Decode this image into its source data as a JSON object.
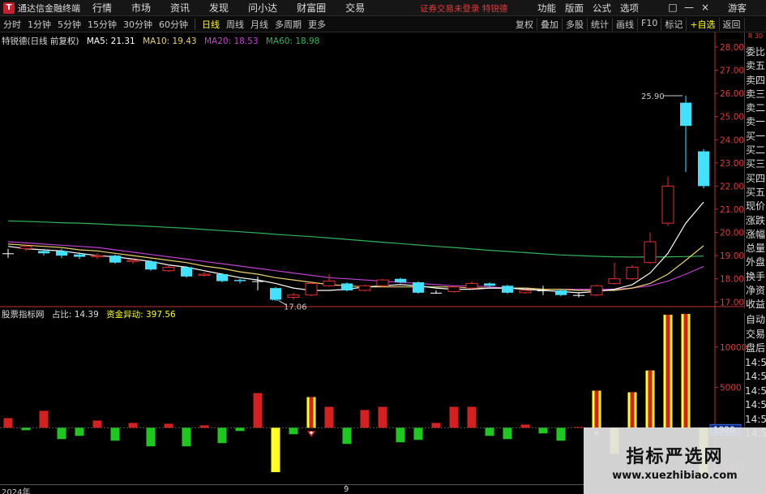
{
  "titlebar": {
    "app_title": "通达信金融终端",
    "menu": [
      "行情",
      "市场",
      "资讯",
      "发现",
      "问小达",
      "财富圈",
      "交易"
    ],
    "login_warning": "证券交易未登录  特锐德",
    "right_menu": [
      "功能",
      "版面",
      "公式",
      "选项"
    ],
    "window_controls": [
      "□",
      "—",
      "×"
    ],
    "zoom_label": "游客"
  },
  "toolbar": {
    "periods": [
      "分时",
      "1分钟",
      "5分钟",
      "15分钟",
      "30分钟",
      "60分钟",
      "日线",
      "周线",
      "月线",
      "多周期",
      "更多"
    ],
    "active_period": "日线",
    "right_tools": [
      "复权",
      "叠加",
      "多股",
      "统计",
      "画线",
      "F10",
      "标记",
      "+自选",
      "返回"
    ]
  },
  "kline_legend": {
    "name": "特锐德(日线 前复权)",
    "ma5": "MA5: 21.31",
    "ma10": "MA10: 19.43",
    "ma20": "MA20: 18.53",
    "ma60": "MA60: 18.98"
  },
  "price_axis": {
    "ticks": [
      "28.00",
      "27.00",
      "26.00",
      "25.00",
      "24.00",
      "23.00",
      "22.00",
      "21.00",
      "20.00",
      "19.00",
      "18.00",
      "17.00"
    ],
    "ymax": 28.0,
    "ymin": 16.8,
    "high_label": "25.90",
    "low_label": "17.06",
    "fin_marker": "财"
  },
  "indicator_legend": {
    "name": "股票指标网",
    "ratio": "占比: 14.39",
    "fund": "资金异动: 397.56"
  },
  "volume_axis": {
    "ticks": [
      "10000",
      "5000",
      "0",
      "-5000"
    ],
    "current_label": "1920",
    "ymax": 13000,
    "ymin": -7000
  },
  "side_panel": {
    "top_label": "R 30",
    "items": [
      "委比",
      "卖五",
      "卖四",
      "卖三",
      "卖二",
      "卖一",
      "买一",
      "买二",
      "买三",
      "买四",
      "买五",
      "现价",
      "涨跌",
      "涨幅",
      "总量",
      "外盘",
      "换手",
      "净资",
      "收益"
    ],
    "items2": [
      "自动",
      "交易",
      "盘后",
      "14:50",
      "14:50",
      "14:50",
      "14:50",
      "14:50",
      "14:50"
    ]
  },
  "x_axis": {
    "year_label": "2024年",
    "mid_label": "9"
  },
  "watermark": {
    "title": "指标严选网",
    "url": "www.xuezhibiao.com"
  },
  "colors": {
    "up": "#e53030",
    "down": "#44e1ff",
    "ma5": "#ffffff",
    "ma10": "#e8d36a",
    "ma20": "#c040d0",
    "ma60": "#2fb35a",
    "vol_up": "#d42020",
    "vol_down": "#1ec81e",
    "signal_yellow": "#ffff20"
  },
  "chart_data": {
    "type": "candlestick",
    "candles": [
      {
        "o": 19.1,
        "c": 19.1,
        "h": 19.3,
        "l": 18.9
      },
      {
        "o": 19.3,
        "c": 19.4,
        "h": 19.5,
        "l": 19.2
      },
      {
        "o": 19.2,
        "c": 19.1,
        "h": 19.3,
        "l": 19.0
      },
      {
        "o": 19.2,
        "c": 19.0,
        "h": 19.3,
        "l": 18.9
      },
      {
        "o": 19.05,
        "c": 18.95,
        "h": 19.15,
        "l": 18.85
      },
      {
        "o": 18.95,
        "c": 19.0,
        "h": 19.1,
        "l": 18.85
      },
      {
        "o": 19.0,
        "c": 18.7,
        "h": 19.05,
        "l": 18.65
      },
      {
        "o": 18.75,
        "c": 18.8,
        "h": 18.9,
        "l": 18.65
      },
      {
        "o": 18.75,
        "c": 18.4,
        "h": 18.8,
        "l": 18.35
      },
      {
        "o": 18.35,
        "c": 18.5,
        "h": 18.6,
        "l": 18.3
      },
      {
        "o": 18.5,
        "c": 18.1,
        "h": 18.55,
        "l": 18.05
      },
      {
        "o": 18.15,
        "c": 18.2,
        "h": 18.3,
        "l": 18.1
      },
      {
        "o": 18.2,
        "c": 17.9,
        "h": 18.25,
        "l": 17.85
      },
      {
        "o": 17.95,
        "c": 17.9,
        "h": 18.0,
        "l": 17.8
      },
      {
        "o": 17.9,
        "c": 17.9,
        "h": 18.1,
        "l": 17.5
      },
      {
        "o": 17.6,
        "c": 17.1,
        "h": 17.65,
        "l": 17.06
      },
      {
        "o": 17.2,
        "c": 17.3,
        "h": 17.4,
        "l": 17.1
      },
      {
        "o": 17.3,
        "c": 17.8,
        "h": 17.85,
        "l": 17.25
      },
      {
        "o": 17.7,
        "c": 17.9,
        "h": 18.2,
        "l": 17.65
      },
      {
        "o": 17.8,
        "c": 17.5,
        "h": 17.85,
        "l": 17.45
      },
      {
        "o": 17.5,
        "c": 17.7,
        "h": 17.75,
        "l": 17.45
      },
      {
        "o": 17.7,
        "c": 17.95,
        "h": 18.0,
        "l": 17.65
      },
      {
        "o": 18.0,
        "c": 17.85,
        "h": 18.05,
        "l": 17.8
      },
      {
        "o": 17.85,
        "c": 17.4,
        "h": 17.9,
        "l": 17.35
      },
      {
        "o": 17.4,
        "c": 17.4,
        "h": 17.5,
        "l": 17.35
      },
      {
        "o": 17.45,
        "c": 17.65,
        "h": 17.7,
        "l": 17.4
      },
      {
        "o": 17.6,
        "c": 17.8,
        "h": 17.9,
        "l": 17.55
      },
      {
        "o": 17.8,
        "c": 17.7,
        "h": 17.85,
        "l": 17.65
      },
      {
        "o": 17.7,
        "c": 17.4,
        "h": 17.75,
        "l": 17.35
      },
      {
        "o": 17.4,
        "c": 17.5,
        "h": 17.55,
        "l": 17.35
      },
      {
        "o": 17.5,
        "c": 17.5,
        "h": 17.7,
        "l": 17.3
      },
      {
        "o": 17.5,
        "c": 17.3,
        "h": 17.55,
        "l": 17.25
      },
      {
        "o": 17.3,
        "c": 17.3,
        "h": 17.4,
        "l": 17.2
      },
      {
        "o": 17.3,
        "c": 17.7,
        "h": 17.75,
        "l": 17.25
      },
      {
        "o": 17.8,
        "c": 18.0,
        "h": 18.7,
        "l": 17.75
      },
      {
        "o": 18.0,
        "c": 18.5,
        "h": 18.6,
        "l": 17.95
      },
      {
        "o": 18.7,
        "c": 19.6,
        "h": 20.0,
        "l": 18.65
      },
      {
        "o": 20.4,
        "c": 22.0,
        "h": 22.4,
        "l": 20.3
      },
      {
        "o": 25.6,
        "c": 24.6,
        "h": 25.9,
        "l": 22.6
      },
      {
        "o": 23.5,
        "c": 22.0,
        "h": 23.6,
        "l": 21.9
      }
    ],
    "ma5": [
      19.4,
      19.3,
      19.25,
      19.2,
      19.1,
      19.0,
      18.95,
      18.85,
      18.75,
      18.6,
      18.5,
      18.35,
      18.2,
      18.05,
      17.95,
      17.8,
      17.6,
      17.5,
      17.5,
      17.55,
      17.65,
      17.7,
      17.75,
      17.7,
      17.6,
      17.55,
      17.55,
      17.6,
      17.6,
      17.55,
      17.5,
      17.45,
      17.4,
      17.45,
      17.55,
      17.75,
      18.25,
      19.1,
      20.4,
      21.31
    ],
    "ma10": [
      19.5,
      19.45,
      19.4,
      19.35,
      19.25,
      19.2,
      19.1,
      19.0,
      18.9,
      18.8,
      18.7,
      18.55,
      18.45,
      18.3,
      18.2,
      18.05,
      17.95,
      17.85,
      17.75,
      17.7,
      17.65,
      17.65,
      17.65,
      17.65,
      17.65,
      17.65,
      17.6,
      17.6,
      17.6,
      17.6,
      17.55,
      17.55,
      17.5,
      17.5,
      17.5,
      17.6,
      17.8,
      18.2,
      18.8,
      19.43
    ],
    "ma20": [
      19.6,
      19.55,
      19.5,
      19.45,
      19.4,
      19.35,
      19.25,
      19.15,
      19.05,
      18.95,
      18.85,
      18.75,
      18.65,
      18.55,
      18.45,
      18.35,
      18.25,
      18.15,
      18.05,
      18.0,
      17.95,
      17.9,
      17.85,
      17.8,
      17.75,
      17.7,
      17.7,
      17.65,
      17.6,
      17.6,
      17.55,
      17.55,
      17.55,
      17.55,
      17.55,
      17.6,
      17.7,
      17.9,
      18.2,
      18.53
    ],
    "ma60": [
      20.5,
      20.48,
      20.45,
      20.42,
      20.4,
      20.37,
      20.33,
      20.3,
      20.26,
      20.22,
      20.18,
      20.13,
      20.08,
      20.03,
      19.98,
      19.92,
      19.87,
      19.82,
      19.76,
      19.7,
      19.64,
      19.58,
      19.52,
      19.46,
      19.4,
      19.35,
      19.29,
      19.23,
      19.18,
      19.13,
      19.08,
      19.03,
      19.0,
      18.97,
      18.95,
      18.94,
      18.94,
      18.95,
      18.96,
      18.98
    ],
    "volume": [
      1200,
      -300,
      2100,
      -1400,
      -1000,
      900,
      -1600,
      600,
      -2300,
      500,
      -2300,
      300,
      -1900,
      -400,
      4300,
      -5500,
      -800,
      3800,
      2600,
      -2000,
      2200,
      2600,
      -1800,
      -1500,
      600,
      2600,
      2600,
      -1000,
      -1400,
      400,
      -700,
      -1600,
      100,
      4600,
      -3200,
      4400,
      7100,
      14000,
      14100,
      -6200
    ],
    "signals": [
      0,
      0,
      0,
      0,
      0,
      0,
      0,
      0,
      0,
      0,
      0,
      0,
      0,
      0,
      0,
      1,
      0,
      1,
      0,
      0,
      0,
      0,
      0,
      0,
      0,
      0,
      0,
      0,
      0,
      0,
      0,
      0,
      0,
      1,
      1,
      1,
      1,
      1,
      1,
      1
    ]
  }
}
